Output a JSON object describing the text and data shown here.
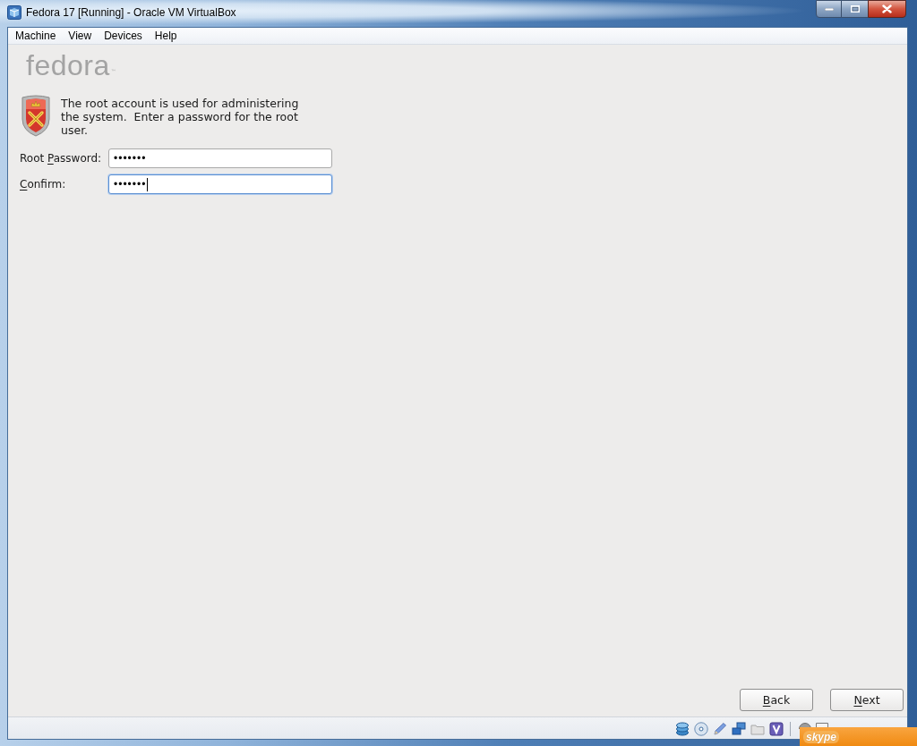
{
  "window": {
    "title": "Fedora 17 [Running] - Oracle VM VirtualBox"
  },
  "menu": [
    "Machine",
    "View",
    "Devices",
    "Help"
  ],
  "installer": {
    "logo": "fedora",
    "logo_mark": "™",
    "intro": "The root account is used for administering the system.  Enter a password for the root user.",
    "fields": [
      {
        "label_start": "Root ",
        "access_key": "P",
        "label_end": "assword:",
        "value": "•••••••",
        "focused": false
      },
      {
        "access_key": "C",
        "label_end": "onfirm:",
        "value": "•••••••",
        "focused": true
      }
    ],
    "buttons": [
      {
        "access_key": "B",
        "label_end": "ack"
      },
      {
        "access_key": "N",
        "label_end": "ext"
      }
    ]
  },
  "overlay": {
    "label": "skype"
  }
}
